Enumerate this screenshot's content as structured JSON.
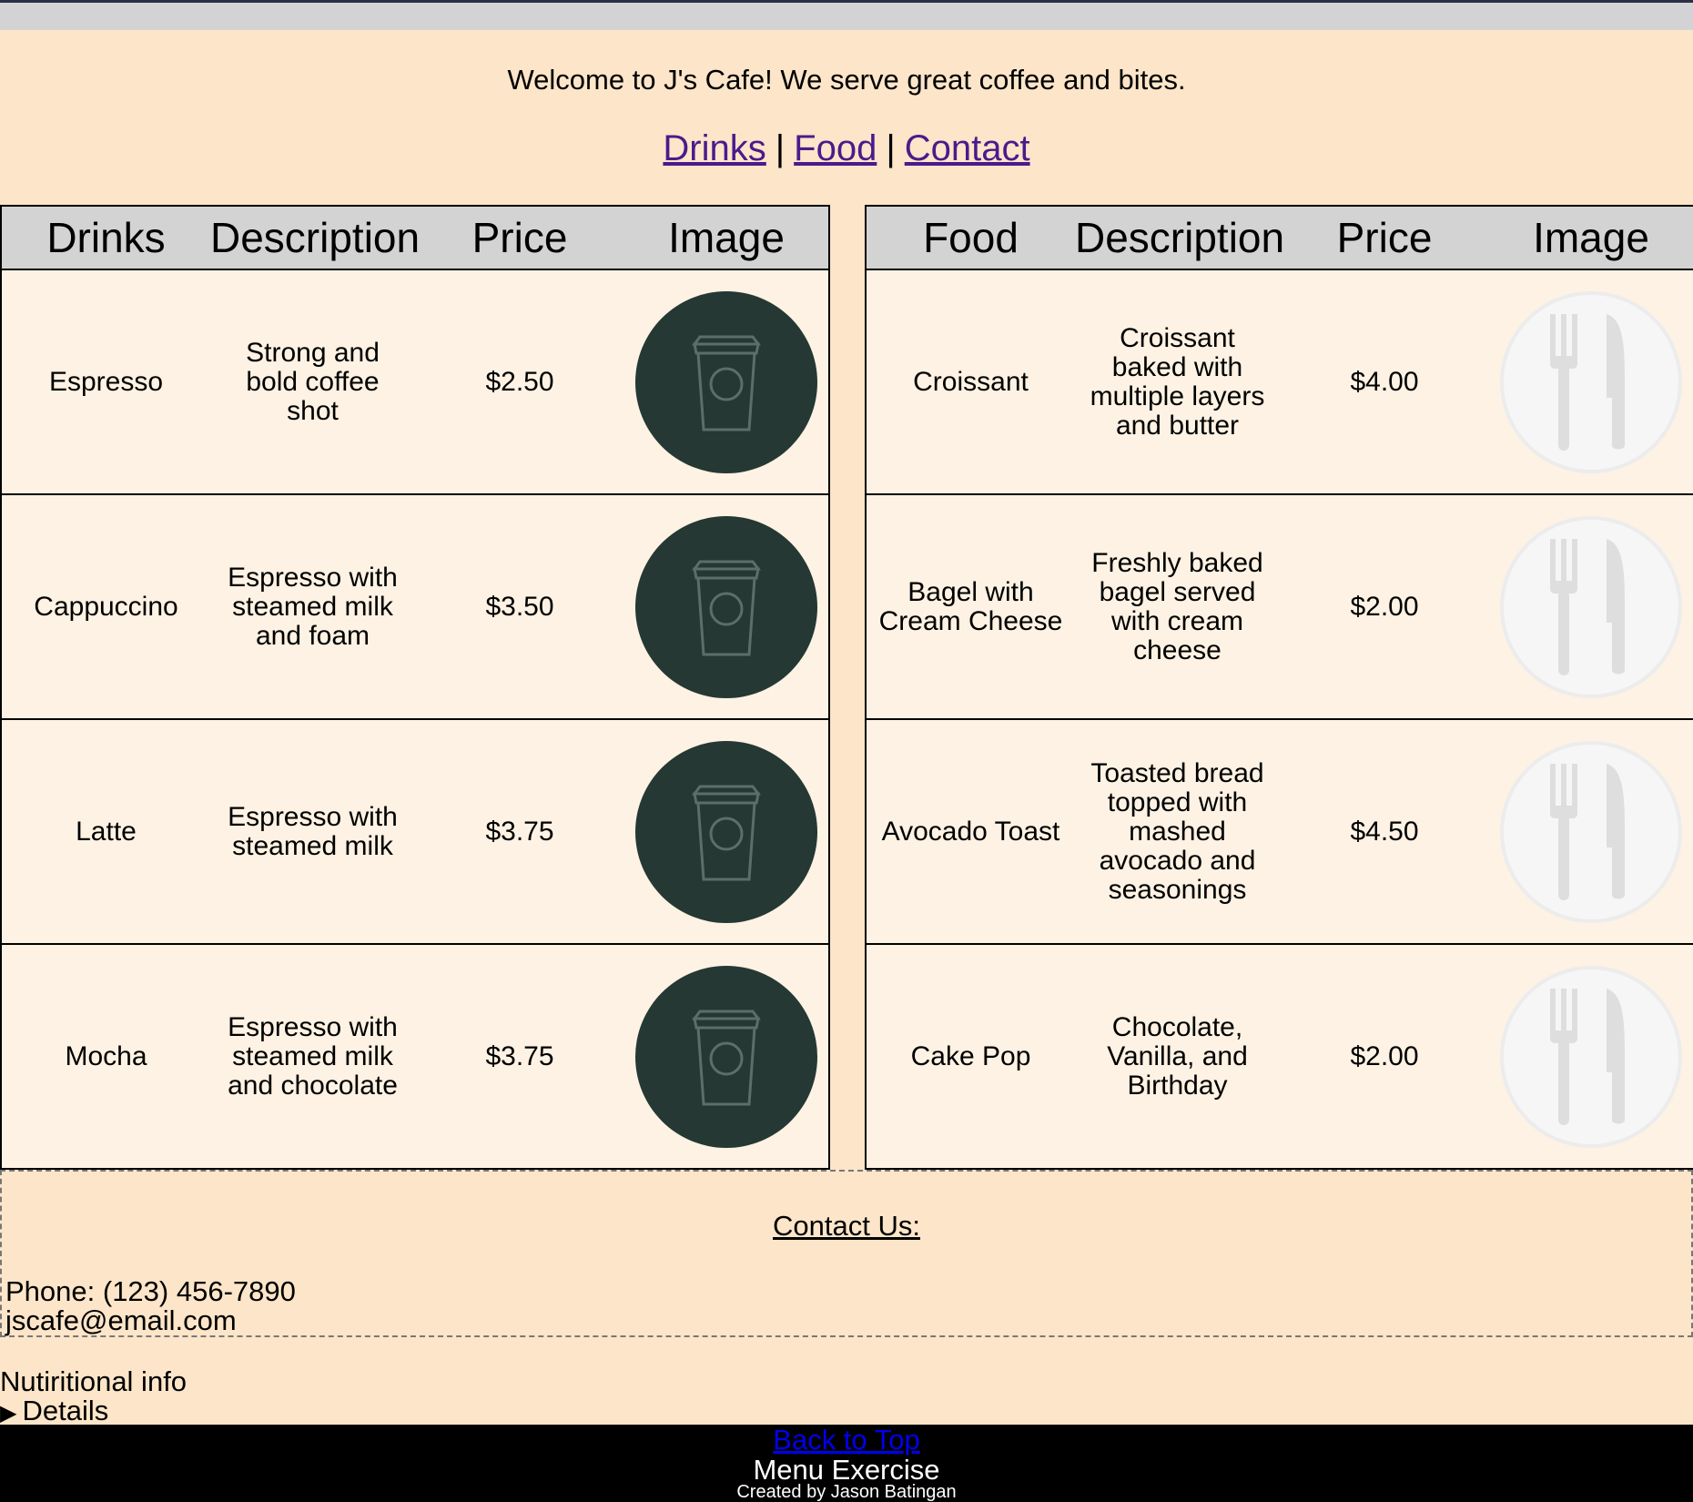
{
  "header": {
    "welcome": "Welcome to J's Cafe! We serve great coffee and bites.",
    "nav": [
      {
        "label": "Drinks"
      },
      {
        "label": "Food"
      },
      {
        "label": "Contact"
      }
    ],
    "separator": "|"
  },
  "drinks_table": {
    "headers": [
      "Drinks",
      "Description",
      "Price",
      "Image"
    ],
    "rows": [
      {
        "name": "Espresso",
        "description": "Strong and bold coffee shot",
        "price": "$2.50",
        "image_icon": "coffee-cup-icon"
      },
      {
        "name": "Cappuccino",
        "description": "Espresso with steamed milk and foam",
        "price": "$3.50",
        "image_icon": "coffee-cup-icon"
      },
      {
        "name": "Latte",
        "description": "Espresso with steamed milk",
        "price": "$3.75",
        "image_icon": "coffee-cup-icon"
      },
      {
        "name": "Mocha",
        "description": "Espresso with steamed milk and chocolate",
        "price": "$3.75",
        "image_icon": "coffee-cup-icon"
      }
    ]
  },
  "food_table": {
    "headers": [
      "Food",
      "Description",
      "Price",
      "Image"
    ],
    "rows": [
      {
        "name": "Croissant",
        "description": "Croissant baked with multiple layers and butter",
        "price": "$4.00",
        "image_icon": "fork-knife-icon"
      },
      {
        "name": "Bagel with Cream Cheese",
        "description": "Freshly baked bagel served with cream cheese",
        "price": "$2.00",
        "image_icon": "fork-knife-icon"
      },
      {
        "name": "Avocado Toast",
        "description": "Toasted bread topped with mashed avocado and seasonings",
        "price": "$4.50",
        "image_icon": "fork-knife-icon"
      },
      {
        "name": "Cake Pop",
        "description": "Chocolate, Vanilla, and Birthday",
        "price": "$2.00",
        "image_icon": "fork-knife-icon"
      }
    ]
  },
  "contact": {
    "title": "Contact Us:",
    "phone": "Phone: (123) 456-7890",
    "email": "jscafe@email.com"
  },
  "nutrition": {
    "label": "Nutiritional info",
    "details": "Details"
  },
  "footer": {
    "back_to_top": "Back to Top",
    "title": "Menu Exercise",
    "credit": "Created by Jason Batingan"
  },
  "colors": {
    "page_bg": "#fce5c8",
    "cell_bg": "#fdf2e3",
    "header_bg": "#d3d3d3",
    "cup_circle": "#253833",
    "link": "#4b1a8c",
    "footer_bg": "#000000"
  }
}
